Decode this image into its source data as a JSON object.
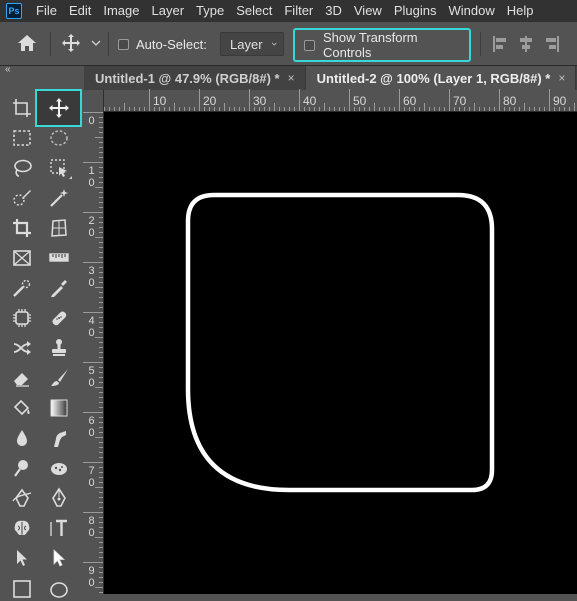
{
  "app": {
    "logo_text": "Ps"
  },
  "menu": [
    "File",
    "Edit",
    "Image",
    "Layer",
    "Type",
    "Select",
    "Filter",
    "3D",
    "View",
    "Plugins",
    "Window",
    "Help"
  ],
  "options": {
    "home_icon": "home-icon",
    "move_icon": "move-icon",
    "auto_select_label": "Auto-Select:",
    "layer_dropdown": "Layer",
    "show_transform_label": "Show Transform Controls",
    "highlight_color": "#3ad7d7"
  },
  "collapse_label": "«",
  "tabs": [
    {
      "label": "Untitled-1 @ 47.9% (RGB/8#) *",
      "close": "×",
      "active": false
    },
    {
      "label": "Untitled-2 @ 100% (Layer 1, RGB/8#) *",
      "close": "×",
      "active": true
    }
  ],
  "ruler_top": [
    "10",
    "20",
    "30",
    "40",
    "50",
    "60",
    "70",
    "80",
    "90"
  ],
  "ruler_left": [
    [
      "0"
    ],
    [
      "1",
      "0"
    ],
    [
      "2",
      "0"
    ],
    [
      "3",
      "0"
    ],
    [
      "4",
      "0"
    ],
    [
      "5",
      "0"
    ],
    [
      "6",
      "0"
    ],
    [
      "7",
      "0"
    ],
    [
      "8",
      "0"
    ],
    [
      "9",
      "0"
    ]
  ],
  "canvas": {
    "background": "#000000",
    "shape_stroke": "#ffffff"
  }
}
